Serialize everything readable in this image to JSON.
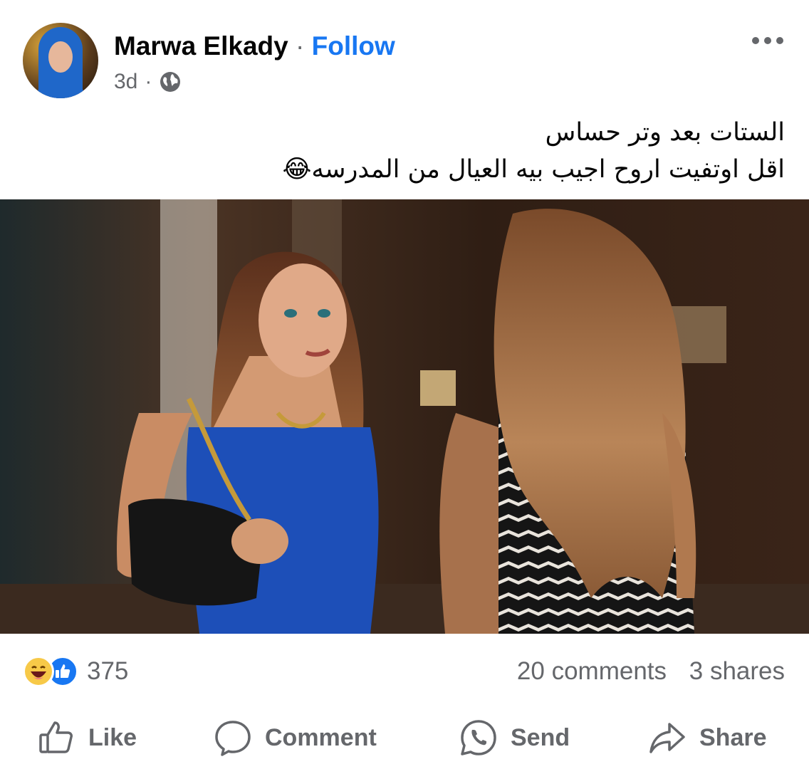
{
  "post": {
    "author": "Marwa Elkady",
    "separator": "·",
    "follow_label": "Follow",
    "time": "3d",
    "meta_separator": "·",
    "audience_icon": "globe-icon",
    "more_icon": "more-options-icon",
    "caption_lines": [
      "الستات بعد وتر حساس",
      "اقل اوتفيت اروح اجيب بيه العيال من المدرسه😂"
    ]
  },
  "stats": {
    "reaction_icons": [
      "haha-reaction-icon",
      "like-reaction-icon"
    ],
    "reaction_count": "375",
    "comments": "20 comments",
    "shares": "3 shares"
  },
  "actions": {
    "like": "Like",
    "comment": "Comment",
    "send": "Send",
    "share": "Share"
  },
  "colors": {
    "accent": "#1877f2",
    "secondary_text": "#65676b",
    "primary_text": "#050505",
    "dress": "#1d4fb8"
  }
}
